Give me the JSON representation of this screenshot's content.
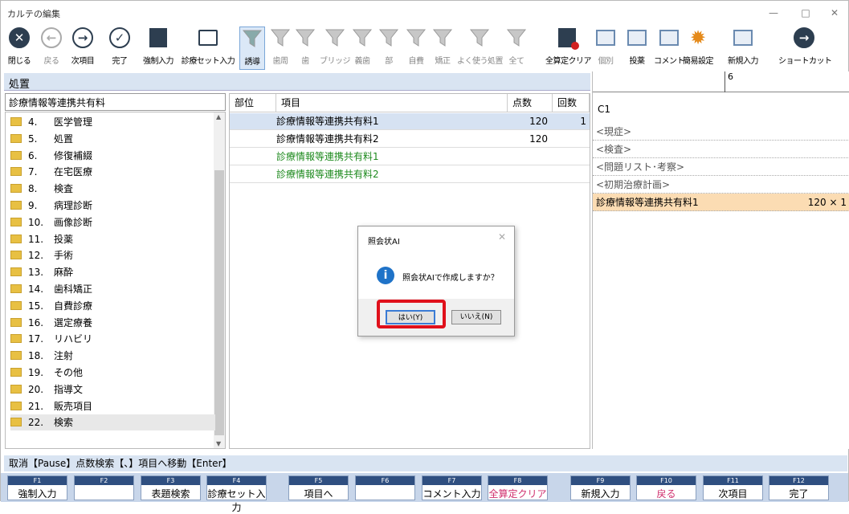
{
  "window": {
    "title": "カルテの編集",
    "minimize": "—",
    "maximize": "□",
    "close": "✕"
  },
  "toolbar": [
    {
      "label": "閉じる",
      "icon": "close-circle-icon",
      "x": 0
    },
    {
      "label": "戻る",
      "icon": "back-arrow-icon",
      "x": 0
    },
    {
      "label": "次項目",
      "icon": "next-arrow-icon",
      "x": 0
    },
    {
      "label": "完了",
      "icon": "check-icon",
      "x": 0
    },
    {
      "label": "強制入力",
      "icon": "form-edit-icon",
      "x": 0
    },
    {
      "label": "診療セット入力",
      "icon": "folder-icon",
      "x": 0
    },
    {
      "label": "誘導",
      "icon": "funnel-icon"
    },
    {
      "label": "歯周",
      "icon": "funnel-icon"
    },
    {
      "label": "歯",
      "icon": "funnel-icon"
    },
    {
      "label": "ブリッジ",
      "icon": "funnel-icon"
    },
    {
      "label": "義歯",
      "icon": "funnel-icon"
    },
    {
      "label": "部",
      "icon": "funnel-icon"
    },
    {
      "label": "自費",
      "icon": "funnel-icon"
    },
    {
      "label": "矯正",
      "icon": "funnel-icon"
    },
    {
      "label": "よく使う処置",
      "icon": "funnel-star-icon"
    },
    {
      "label": "全て",
      "icon": "funnel-clear-icon"
    },
    {
      "label": "全算定クリア",
      "icon": "calc-clear-icon"
    },
    {
      "label": "個別",
      "icon": "grid-icon"
    },
    {
      "label": "投薬",
      "icon": "grid-add-icon"
    },
    {
      "label": "コメント",
      "icon": "grid-add-icon"
    },
    {
      "label": "簡易設定",
      "icon": "gear-icon"
    },
    {
      "label": "新規入力",
      "icon": "grid-add-icon"
    },
    {
      "label": "ショートカット",
      "icon": "shortcut-arrow-icon"
    }
  ],
  "panel": {
    "title": "処置",
    "search_value": "診療情報等連携共有料"
  },
  "tree": [
    {
      "num": "4.",
      "label": "医学管理"
    },
    {
      "num": "5.",
      "label": "処置"
    },
    {
      "num": "6.",
      "label": "修復補綴"
    },
    {
      "num": "7.",
      "label": "在宅医療"
    },
    {
      "num": "8.",
      "label": "検査"
    },
    {
      "num": "9.",
      "label": "病理診断"
    },
    {
      "num": "10.",
      "label": "画像診断"
    },
    {
      "num": "11.",
      "label": "投薬"
    },
    {
      "num": "12.",
      "label": "手術"
    },
    {
      "num": "13.",
      "label": "麻酔"
    },
    {
      "num": "14.",
      "label": "歯科矯正"
    },
    {
      "num": "15.",
      "label": "自費診療"
    },
    {
      "num": "16.",
      "label": "選定療養"
    },
    {
      "num": "17.",
      "label": "リハビリ"
    },
    {
      "num": "18.",
      "label": "注射"
    },
    {
      "num": "19.",
      "label": "その他"
    },
    {
      "num": "20.",
      "label": "指導文"
    },
    {
      "num": "21.",
      "label": "販売項目"
    },
    {
      "num": "22.",
      "label": "検索"
    }
  ],
  "table": {
    "headers": {
      "part": "部位",
      "item": "項目",
      "points": "点数",
      "count": "回数"
    },
    "rows": [
      {
        "item": "診療情報等連携共有料1",
        "points": "120",
        "count": "1",
        "green": false
      },
      {
        "item": "診療情報等連携共有料2",
        "points": "120",
        "count": "",
        "green": false
      },
      {
        "item": "診療情報等連携共有料1",
        "points": "",
        "count": "",
        "green": true
      },
      {
        "item": "診療情報等連携共有料2",
        "points": "",
        "count": "",
        "green": true
      }
    ]
  },
  "right": {
    "ruler_mark": "6",
    "tooth": "C1",
    "rows": [
      "<現症>",
      "<検査>",
      "<問題リスト･考察>",
      "<初期治療計画>"
    ],
    "entry": {
      "label": "診療情報等連携共有料1",
      "value": "120 × 1"
    }
  },
  "status": "取消【Pause】点数検索【、】項目へ移動【Enter】",
  "fkeys": [
    {
      "key": "F1",
      "label": "強制入力",
      "pink": false
    },
    {
      "key": "F2",
      "label": "",
      "pink": false
    },
    {
      "key": "F3",
      "label": "表題検索",
      "pink": false
    },
    {
      "key": "F4",
      "label": "診療セット入力",
      "pink": false
    },
    {
      "key": "F5",
      "label": "項目へ",
      "pink": false
    },
    {
      "key": "F6",
      "label": "",
      "pink": false
    },
    {
      "key": "F7",
      "label": "コメント入力",
      "pink": false
    },
    {
      "key": "F8",
      "label": "全算定クリア",
      "pink": true
    },
    {
      "key": "F9",
      "label": "新規入力",
      "pink": false
    },
    {
      "key": "F10",
      "label": "戻る",
      "pink": true
    },
    {
      "key": "F11",
      "label": "次項目",
      "pink": false
    },
    {
      "key": "F12",
      "label": "完了",
      "pink": false
    }
  ],
  "dialog": {
    "title": "照会状AI",
    "close": "✕",
    "icon": "i",
    "message": "照会状AIで作成しますか？",
    "yes": "はい(Y)",
    "no": "いいえ(N)"
  }
}
